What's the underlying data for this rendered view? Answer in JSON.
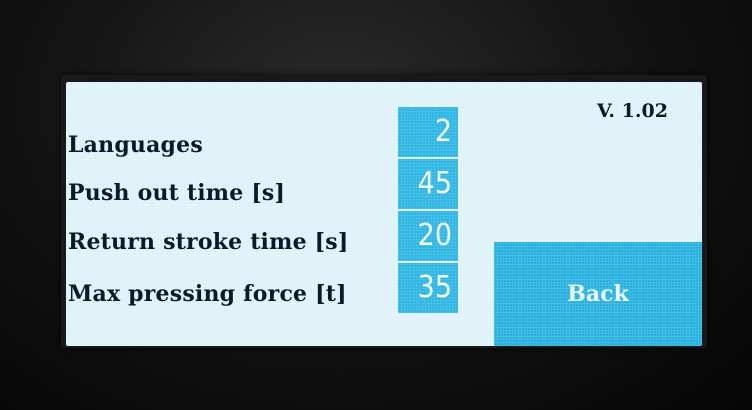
{
  "version": "V. 1.02",
  "settings": [
    {
      "label": "Languages",
      "value": "2"
    },
    {
      "label": "Push out time [s]",
      "value": "45"
    },
    {
      "label": "Return stroke time [s]",
      "value": "20"
    },
    {
      "label": "Max pressing force [t]",
      "value": "35"
    }
  ],
  "back_label": "Back",
  "colors": {
    "display_background": "#ddf2f8",
    "accent": "#2fb6e3",
    "text": "#0a1a2a"
  }
}
